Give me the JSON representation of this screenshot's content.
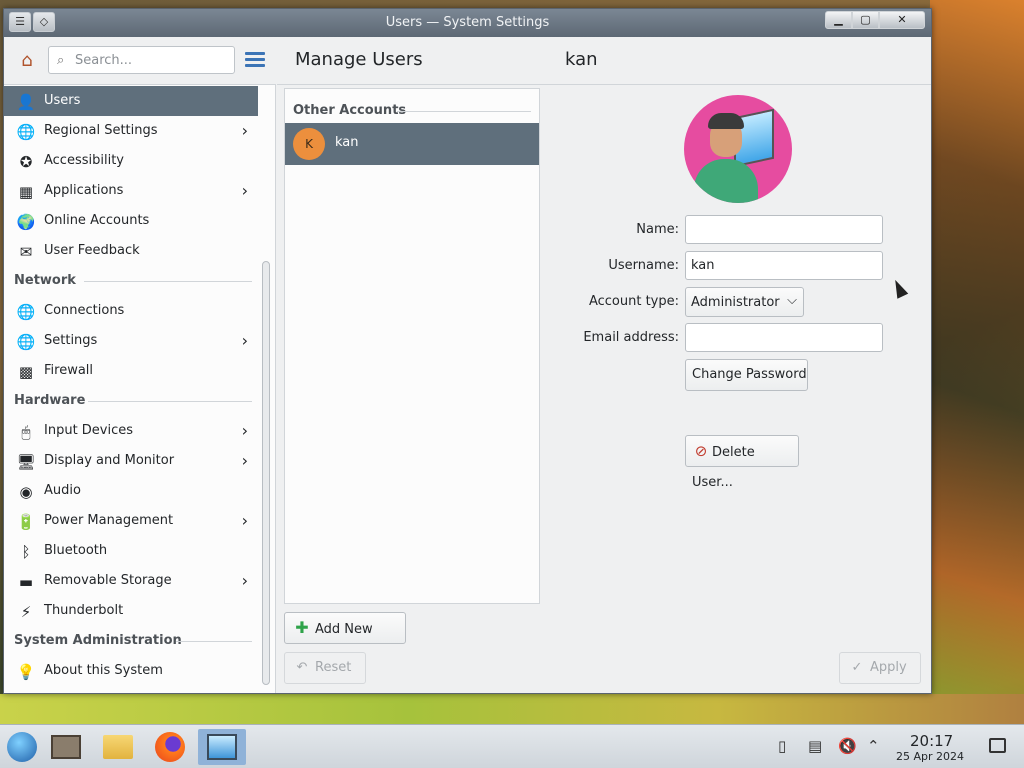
{
  "window": {
    "title": "Users — System Settings",
    "controls": {
      "minimize": "▁",
      "maximize": "▢",
      "close": "✕"
    }
  },
  "sidebar": {
    "search_placeholder": "Search...",
    "items": [
      {
        "label": "Users",
        "icon": "users-icon",
        "glyph": "👤",
        "active": true,
        "has_children": false
      },
      {
        "label": "Regional Settings",
        "icon": "globe-icon",
        "glyph": "🌐",
        "has_children": true
      },
      {
        "label": "Accessibility",
        "icon": "accessibility-icon",
        "glyph": "✪",
        "has_children": false
      },
      {
        "label": "Applications",
        "icon": "applications-icon",
        "glyph": "▦",
        "has_children": true
      },
      {
        "label": "Online Accounts",
        "icon": "online-accounts-icon",
        "glyph": "🌍",
        "has_children": false
      },
      {
        "label": "User Feedback",
        "icon": "feedback-icon",
        "glyph": "✉",
        "has_children": false
      }
    ],
    "network_section": "Network",
    "network_items": [
      {
        "label": "Connections",
        "icon": "connections-icon",
        "glyph": "🌐",
        "has_children": false
      },
      {
        "label": "Settings",
        "icon": "network-settings-icon",
        "glyph": "🌐",
        "has_children": true
      },
      {
        "label": "Firewall",
        "icon": "firewall-icon",
        "glyph": "▩",
        "has_children": false
      }
    ],
    "hardware_section": "Hardware",
    "hardware_items": [
      {
        "label": "Input Devices",
        "icon": "mouse-icon",
        "glyph": "🖱",
        "has_children": true
      },
      {
        "label": "Display and Monitor",
        "icon": "monitor-icon",
        "glyph": "🖥",
        "has_children": true
      },
      {
        "label": "Audio",
        "icon": "audio-icon",
        "glyph": "◉",
        "has_children": false
      },
      {
        "label": "Power Management",
        "icon": "power-icon",
        "glyph": "🔋",
        "has_children": true
      },
      {
        "label": "Bluetooth",
        "icon": "bluetooth-icon",
        "glyph": "ᛒ",
        "has_children": false
      },
      {
        "label": "Removable Storage",
        "icon": "storage-icon",
        "glyph": "▬",
        "has_children": true
      },
      {
        "label": "Thunderbolt",
        "icon": "thunderbolt-icon",
        "glyph": "⚡",
        "has_children": false
      }
    ],
    "sysadmin_section": "System Administration",
    "sysadmin_items": [
      {
        "label": "About this System",
        "icon": "lightbulb-icon",
        "glyph": "💡",
        "has_children": false
      }
    ]
  },
  "main": {
    "title": "Manage Users",
    "selected_user": "kan",
    "accounts_caption": "Other Accounts",
    "accounts": [
      {
        "initial": "K",
        "name": "kan"
      }
    ],
    "add_user_label": "Add New User",
    "reset_label": "Reset",
    "apply_label": "Apply",
    "form": {
      "name_label": "Name:",
      "name_value": "",
      "username_label": "Username:",
      "username_value": "kan",
      "account_type_label": "Account type:",
      "account_type_value": "Administrator",
      "email_label": "Email address:",
      "email_value": "",
      "change_password_label": "Change Password",
      "delete_user_label": "Delete User..."
    }
  },
  "taskbar": {
    "time": "20:17",
    "date": "25 Apr 2024"
  },
  "colors": {
    "accent": "#3b74b6",
    "selection": "#5f6f7c",
    "avatar_bg": "#e64ca0",
    "initial_bg": "#ec8f3d"
  }
}
